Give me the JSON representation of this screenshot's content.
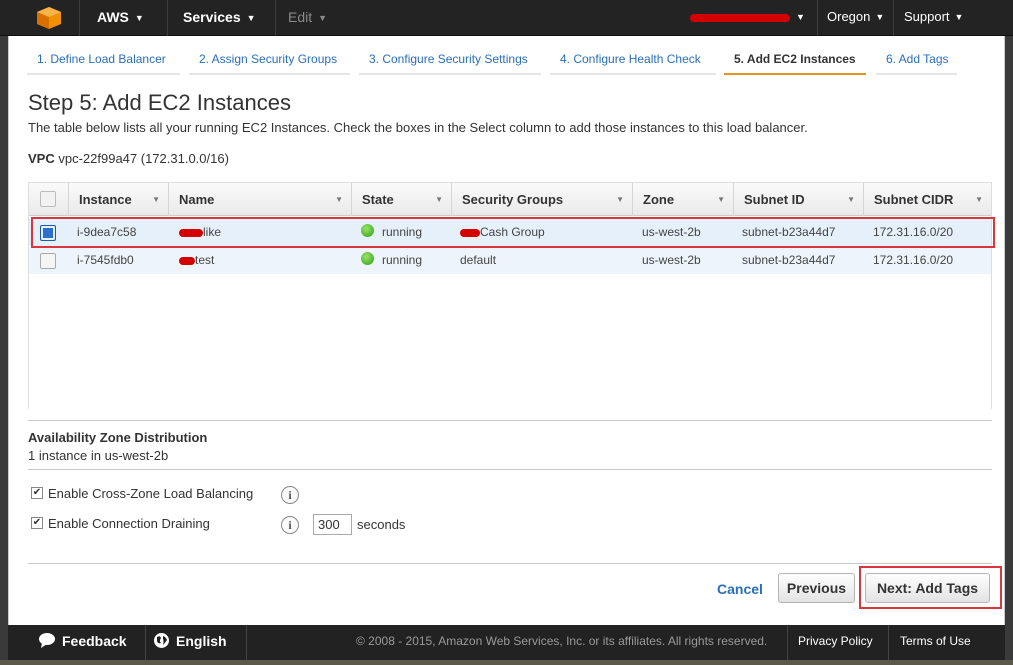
{
  "nav": {
    "aws": "AWS",
    "services": "Services",
    "edit": "Edit",
    "region": "Oregon",
    "support": "Support"
  },
  "steps": [
    {
      "label": "1. Define Load Balancer"
    },
    {
      "label": "2. Assign Security Groups"
    },
    {
      "label": "3. Configure Security Settings"
    },
    {
      "label": "4. Configure Health Check"
    },
    {
      "label": "5. Add EC2 Instances"
    },
    {
      "label": "6. Add Tags"
    }
  ],
  "page": {
    "title": "Step 5: Add EC2 Instances",
    "subtitle": "The table below lists all your running EC2 Instances. Check the boxes in the Select column to add those instances to this load balancer.",
    "vpc_label": "VPC",
    "vpc_value": "vpc-22f99a47 (172.31.0.0/16)"
  },
  "table": {
    "columns": [
      "Instance",
      "Name",
      "State",
      "Security Groups",
      "Zone",
      "Subnet ID",
      "Subnet CIDR"
    ],
    "rows": [
      {
        "selected": true,
        "instance": "i-9dea7c58",
        "name": "like",
        "state": "running",
        "security_groups": "Cash Group",
        "zone": "us-west-2b",
        "subnet_id": "subnet-b23a44d7",
        "subnet_cidr": "172.31.16.0/20"
      },
      {
        "selected": false,
        "instance": "i-7545fdb0",
        "name": "test",
        "state": "running",
        "security_groups": "default",
        "zone": "us-west-2b",
        "subnet_id": "subnet-b23a44d7",
        "subnet_cidr": "172.31.16.0/20"
      }
    ]
  },
  "availability": {
    "title": "Availability Zone Distribution",
    "text": "1 instance in us-west-2b"
  },
  "options": {
    "cross_zone": "Enable Cross-Zone Load Balancing",
    "draining": "Enable Connection Draining",
    "draining_value": "300",
    "seconds": "seconds"
  },
  "buttons": {
    "cancel": "Cancel",
    "previous": "Previous",
    "next": "Next: Add Tags"
  },
  "footer": {
    "feedback": "Feedback",
    "language": "English",
    "copyright": "© 2008 - 2015, Amazon Web Services, Inc. or its affiliates. All rights reserved.",
    "privacy": "Privacy Policy",
    "terms": "Terms of Use"
  },
  "colors": {
    "accent": "#e69422",
    "link": "#2a6ebb",
    "highlight": "#d9363e"
  }
}
